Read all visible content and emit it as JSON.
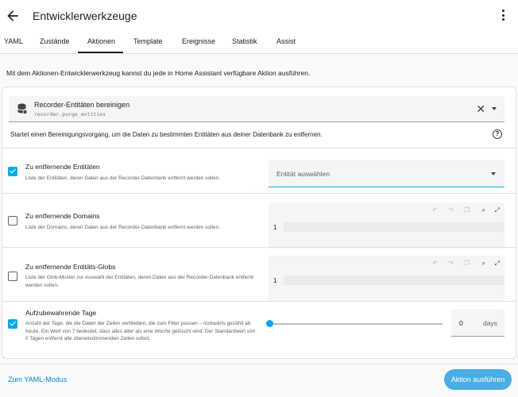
{
  "header": {
    "title": "Entwicklerwerkzeuge",
    "back_icon": "arrow-left-icon",
    "menu_icon": "dots-vertical-icon"
  },
  "tabs": [
    {
      "label": "YAML",
      "active": false
    },
    {
      "label": "Zustände",
      "active": false
    },
    {
      "label": "Aktionen",
      "active": true
    },
    {
      "label": "Template",
      "active": false
    },
    {
      "label": "Ereignisse",
      "active": false
    },
    {
      "label": "Statistik",
      "active": false
    },
    {
      "label": "Assist",
      "active": false
    }
  ],
  "intro": "Mit dem Aktionen-Entwicklerwerkzeug kannst du jede in Home Assistant verfügbare Aktion ausführen.",
  "action_picker": {
    "name": "Recorder-Entitäten bereinigen",
    "service": "recorder.purge_entities",
    "icon": "database-icon"
  },
  "action_description": "Startet einen Bereinigungsvorgang, um die Daten zu bestimmten Entitäten aus deiner Datenbank zu entfernen.",
  "fields": {
    "entities": {
      "title": "Zu entfernende Entitäten",
      "description": "Liste der Entitäten, deren Daten aus der Recorder-Datenbank entfernt werden sollen.",
      "checked": true,
      "placeholder": "Entität auswählen"
    },
    "domains": {
      "title": "Zu entfernende Domains",
      "description": "Liste der Domains, deren Daten aus der Recorder-Datenbank entfernt werden sollen.",
      "checked": false,
      "line_number": "1"
    },
    "globs": {
      "title": "Zu entfernende Entitäts-Globs",
      "description": "Liste der Glob-Muster zur Auswahl der Entitäten, deren Daten aus der Recorder-Datenbank entfernt werden sollen.",
      "checked": false,
      "line_number": "1"
    },
    "keep_days": {
      "title": "Aufzubewahrende Tage",
      "description": "Anzahl der Tage, die die Daten der Zeilen verbleiben, die zum Filter passen – rückwärts gezählt ab heute. Ein Wert von  7  bedeutet, dass alles älter als eine Woche gelöscht wird. Der Standardwert von 0 Tagen entfernt alle übereinstimmenden Zeilen sofort.",
      "checked": true,
      "value": "0",
      "unit": "days",
      "slider_fraction": 0
    }
  },
  "bottom": {
    "yaml_mode": "Zum YAML-Modus",
    "run_action": "Aktion ausführen"
  },
  "colors": {
    "accent": "#03a9f4",
    "button": "#48aee5",
    "link": "#0288d1"
  }
}
